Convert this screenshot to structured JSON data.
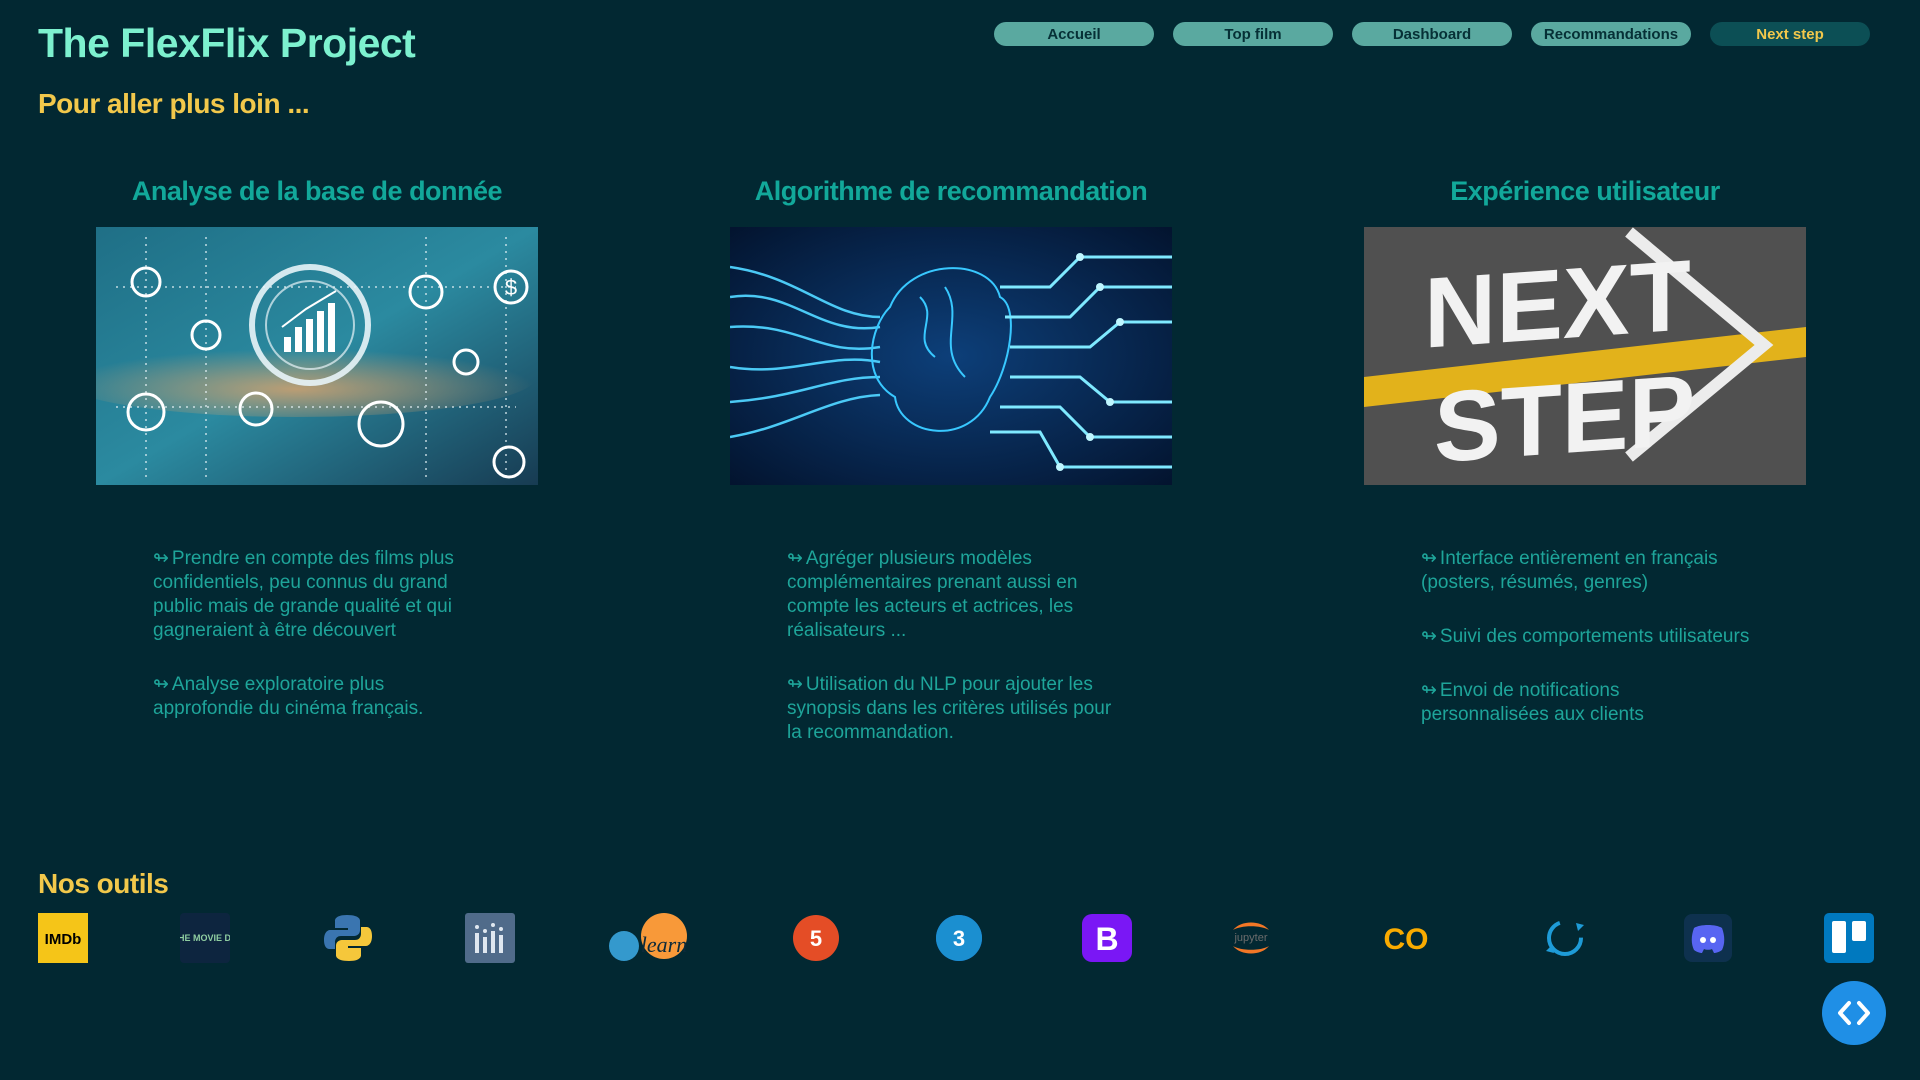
{
  "header": {
    "app_title": "The FlexFlix Project",
    "subtitle": "Pour aller plus loin ..."
  },
  "nav": [
    {
      "label": "Accueil",
      "active": false
    },
    {
      "label": "Top film",
      "active": false
    },
    {
      "label": "Dashboard",
      "active": false
    },
    {
      "label": "Recommandations",
      "active": false
    },
    {
      "label": "Next step",
      "active": true
    }
  ],
  "sections": [
    {
      "title": "Analyse de la base de donnée",
      "image": "data-analytics-illustration",
      "bullets": [
        "Prendre en compte des films plus confidentiels, peu connus du grand public mais de grande qualité et qui gagneraient à être découvert",
        "Analyse exploratoire plus approfondie du cinéma français."
      ]
    },
    {
      "title": "Algorithme de recommandation",
      "image": "ai-brain-circuit-illustration",
      "bullets": [
        "Agréger plusieurs modèles complémentaires prenant aussi en compte les acteurs et actrices, les réalisateurs ...",
        "Utilisation du NLP pour ajouter les synopsis dans les critères utilisés pour la recommandation."
      ]
    },
    {
      "title": "Expérience utilisateur",
      "image": "next-step-road-illustration",
      "image_text": [
        "NEXT",
        "STEP"
      ],
      "bullets": [
        "Interface entièrement en français (posters, résumés, genres)",
        "Suivi des comportements utilisateurs",
        "Envoi de notifications personnalisées aux clients"
      ]
    }
  ],
  "bullet_glyph": "↬",
  "tools": {
    "title": "Nos outils",
    "items": [
      {
        "name": "imdb",
        "text": "IMDb"
      },
      {
        "name": "tmdb",
        "text": "THE MOVIE DB"
      },
      {
        "name": "python"
      },
      {
        "name": "metabase"
      },
      {
        "name": "scikit-learn",
        "text": "learn"
      },
      {
        "name": "html5",
        "text": "5"
      },
      {
        "name": "css3",
        "text": "3"
      },
      {
        "name": "bootstrap",
        "text": "B"
      },
      {
        "name": "jupyter",
        "text": "jupyter"
      },
      {
        "name": "google-colab",
        "text": "CO"
      },
      {
        "name": "kaggle-api"
      },
      {
        "name": "discord"
      },
      {
        "name": "trello"
      }
    ]
  },
  "colors": {
    "background": "#022832",
    "title": "#7df1cf",
    "accent_yellow": "#f2c84b",
    "section_title": "#12a89a",
    "text": "#1ea59a",
    "nav_button": "#5aa9a0",
    "nav_active": "#0c4f55",
    "fab": "#1f8fe6"
  }
}
